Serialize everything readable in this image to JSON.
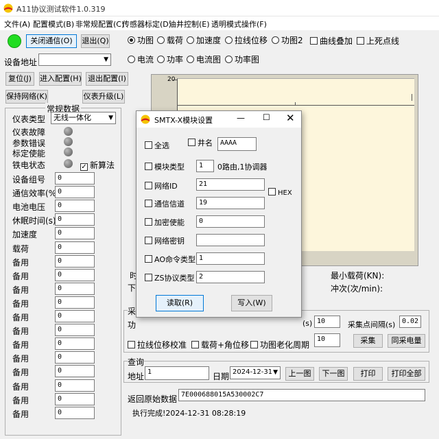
{
  "window": {
    "title": "A11协议测试软件1.0.319"
  },
  "menu": [
    "文件(A)",
    "配置模式(B)",
    "非常规配置(C)",
    "传感器标定(D)",
    "油井控制(E)",
    "透明模式操作(F)"
  ],
  "left": {
    "close_comm": "关闭通信(O)",
    "exit": "退出(Q)",
    "device_addr_label": "设备地址",
    "device_addr_value": "",
    "reset": "复位(J)",
    "enter_config": "进入配置(H)",
    "exit_config": "退出配置(I)",
    "keep_network": "保持网络(K)",
    "upgrade": "仪表升级(L)",
    "group_title": "常规数据",
    "meter_type_label": "仪表类型",
    "meter_type_value": "无线一体化",
    "status": [
      "仪表故障",
      "参数错误",
      "标定使能",
      "铁电状态"
    ],
    "new_algo": "新算法",
    "fields": [
      {
        "label": "设备组号",
        "value": "0"
      },
      {
        "label": "通信效率(%)",
        "value": "0"
      },
      {
        "label": "电池电压",
        "value": "0"
      },
      {
        "label": "休眠时间(s)",
        "value": "0"
      },
      {
        "label": "加速度",
        "value": "0"
      },
      {
        "label": "载荷",
        "value": "0"
      },
      {
        "label": "备用",
        "value": "0"
      },
      {
        "label": "备用",
        "value": "0"
      },
      {
        "label": "备用",
        "value": "0"
      },
      {
        "label": "备用",
        "value": "0"
      },
      {
        "label": "备用",
        "value": "0"
      },
      {
        "label": "备用",
        "value": "0"
      },
      {
        "label": "备用",
        "value": "0"
      },
      {
        "label": "备用",
        "value": "0"
      },
      {
        "label": "备用",
        "value": "0"
      },
      {
        "label": "备用",
        "value": "0"
      },
      {
        "label": "备用",
        "value": "0"
      },
      {
        "label": "备用",
        "value": "0"
      }
    ]
  },
  "radios_row1": [
    {
      "label": "功图",
      "checked": true
    },
    {
      "label": "载荷",
      "checked": false
    },
    {
      "label": "加速度",
      "checked": false
    },
    {
      "label": "拉线位移",
      "checked": false
    },
    {
      "label": "功图2",
      "checked": false
    }
  ],
  "checks_row1": [
    "曲线叠加",
    "上死点线"
  ],
  "radios_row2": [
    {
      "label": "电流",
      "checked": false
    },
    {
      "label": "功率",
      "checked": false
    },
    {
      "label": "电流图",
      "checked": false
    },
    {
      "label": "功率图",
      "checked": false
    }
  ],
  "chart": {
    "ytick_top": "20"
  },
  "stats": {
    "min_load": "最小载荷(KN):",
    "stroke_rate": "冲次(次/min):",
    "left_cut1": "时",
    "left_cut2": "下"
  },
  "collect": {
    "title_cut": "采",
    "row_label_cut": "功",
    "s_label": "(s)",
    "s_value": "10",
    "interval_label": "采集点间隔(s)",
    "interval_value": "0.02",
    "checks": [
      "拉线位移校准",
      "载荷+角位移",
      "功图老化周期"
    ],
    "aging_value": "10",
    "collect_btn": "采集",
    "sync_btn": "同采电量"
  },
  "query": {
    "title": "查询",
    "addr_label": "地址",
    "addr_value": "1",
    "date_label": "日期",
    "date_value": "2024-12-31",
    "prev": "上一图",
    "next": "下一图",
    "print": "打印",
    "print_all": "打印全部"
  },
  "raw": {
    "label": "返回原始数据",
    "value": "7E000688015A530002C7"
  },
  "status_text": "执行完成!2024-12-31 08:28:19",
  "dialog": {
    "title": "SMTX-X模块设置",
    "select_all": "全选",
    "well_name_label": "井名",
    "well_name_value": "AAAA",
    "module_type_label": "模块类型",
    "module_type_value": "1",
    "module_type_hint": "0路由,1协调器",
    "network_id_label": "网络ID",
    "network_id_value": "21",
    "hex_label": "HEX",
    "channel_label": "通信信道",
    "channel_value": "19",
    "encrypt_label": "加密使能",
    "encrypt_value": "0",
    "netkey_label": "网络密钥",
    "netkey_value": "",
    "ao_label": "AO命令类型",
    "ao_value": "1",
    "zs_label": "ZS协议类型",
    "zs_value": "2",
    "read_btn": "读取(R)",
    "write_btn": "写入(W)"
  },
  "colors": {
    "led_green": "#22dd22",
    "plot_bg": "#fdf6dc",
    "chart_bg": "#d8d4c4"
  }
}
